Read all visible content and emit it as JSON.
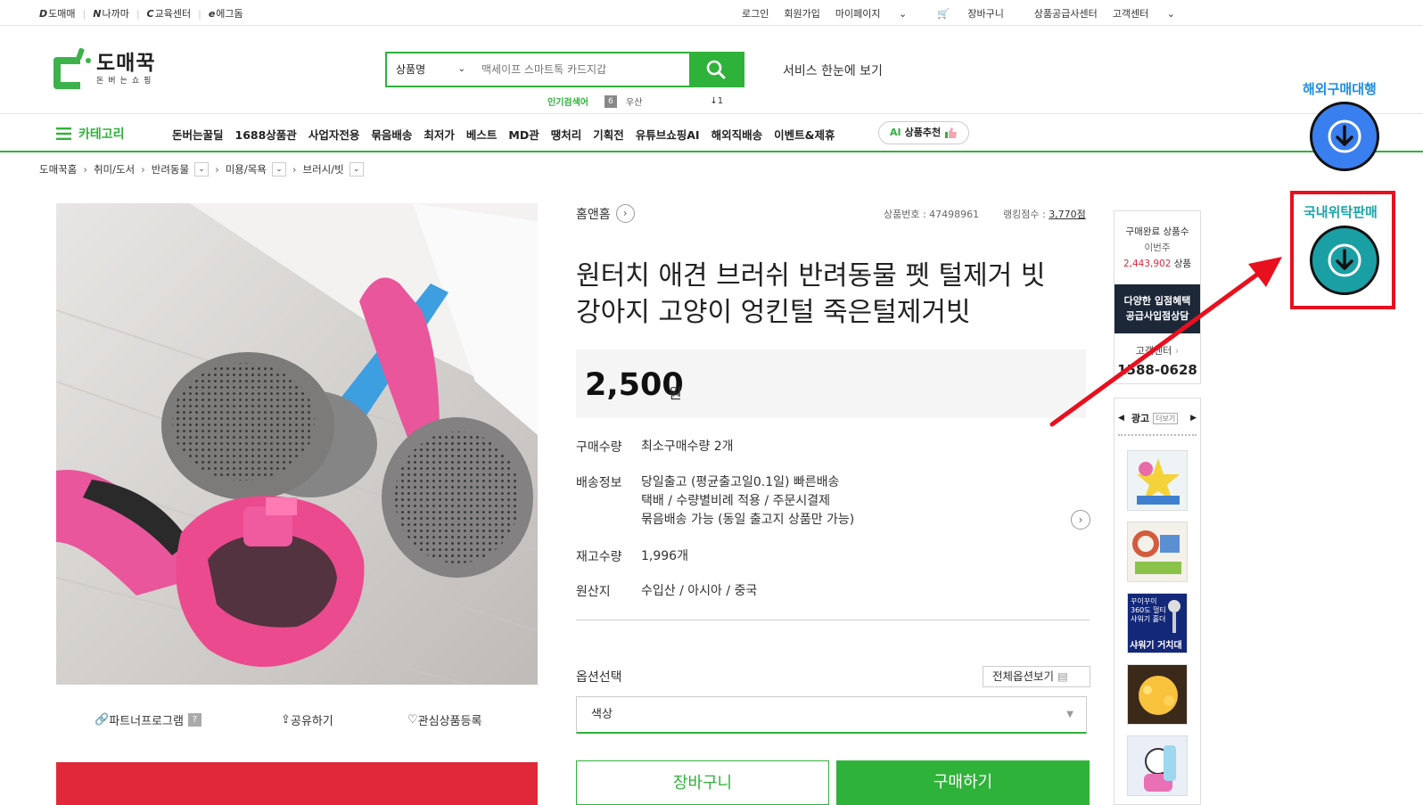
{
  "topbar": {
    "sites": [
      {
        "mark": "D",
        "label": "도매매"
      },
      {
        "mark": "N",
        "label": "나까마"
      },
      {
        "mark": "C",
        "label": "교육센터"
      },
      {
        "mark": "e",
        "label": "에그돔"
      }
    ],
    "util": [
      "로그인",
      "회원가입",
      "마이페이지",
      "장바구니",
      "상품공급사센터",
      "고객센터"
    ]
  },
  "header": {
    "logo_name": "도매꾹",
    "logo_sub": "돈버는쇼핑",
    "search_type": "상품명",
    "search_placeholder": "맥세이프 스마트톡 카드지갑",
    "popular_label": "인기검색어",
    "popular_rank": "6",
    "popular_keyword": "우산",
    "popular_change": "↓1",
    "service_link": "서비스 한눈에 보기"
  },
  "nav": {
    "category": "카테고리",
    "menu": [
      "돈버는꿀딜",
      "1688상품관",
      "사업자전용",
      "묶음배송",
      "최저가",
      "베스트",
      "MD관",
      "땡처리",
      "기획전",
      "유튜브쇼핑AI",
      "해외직배송",
      "이벤트&제휴"
    ],
    "ai_button": "상품추천",
    "ai_prefix": "AI"
  },
  "breadcrumb": [
    "도매꾹홈",
    "취미/도서",
    "반려동물",
    "미용/목욕",
    "브러시/빗"
  ],
  "product": {
    "seller": "홈앤홈",
    "product_no": "상품번호 : 47498961",
    "rank_label": "랭킹점수 : ",
    "rank_value": "3,770점",
    "title_line1": "원터치 애견 브러쉬 반려동물 펫 털제거 빗",
    "title_line2": "강아지 고양이 엉킨털 죽은털제거빗",
    "price": "2,500",
    "currency": "원",
    "qty_label": "구매수량",
    "qty_value": "최소구매수량 2개",
    "ship_label": "배송정보",
    "ship_line1": "당일출고 (평균출고일0.1일)  빠른배송",
    "ship_line2": "택배 / 수량별비례 적용 / 주문시결제",
    "ship_line3": "묶음배송 가능 (동일 출고지 상품만 가능)",
    "stock_label": "재고수량",
    "stock_value": "1,996개",
    "origin_label": "원산지",
    "origin_value": "수입산 / 아시아 / 중국",
    "option_label": "옵션선택",
    "option_all": "전체옵션보기",
    "option_select": "색상",
    "cart_button": "장바구니",
    "buy_button": "구매하기"
  },
  "image_actions": {
    "partner": "파트너프로그램",
    "share": "공유하기",
    "wish": "관심상품등록"
  },
  "side": {
    "completed_label": "구매완료 상품수",
    "week_label": "이번주",
    "count": "2,443,902",
    "count_unit": "상품",
    "promo_line1": "다양한 입점혜택",
    "promo_line2": "공급사입점상담",
    "cs_label": "고객센터",
    "tel": "1588-0628",
    "ad_label": "광고",
    "ad_more": "더보기",
    "ad3_text1": "꾸이꾸이 360도 멀티 샤워기 홀더",
    "ad3_text2": "샤워기 거치대"
  },
  "overlay": {
    "overseas_label": "해외구매대행",
    "domestic_label": "국내위탁판매"
  },
  "colors": {
    "brand_green": "#2fb23a",
    "price_red": "#e0283a",
    "annotation_red": "#e8101e",
    "fab_blue": "#3a7ff0",
    "fab_teal": "#1a9fa5"
  }
}
